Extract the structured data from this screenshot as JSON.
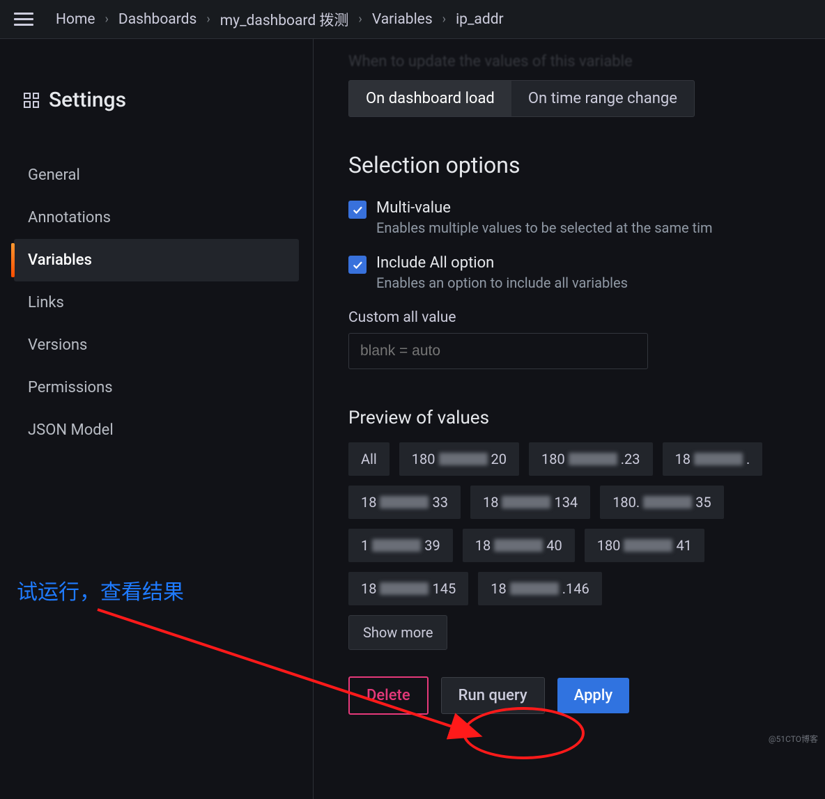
{
  "breadcrumbs": [
    "Home",
    "Dashboards",
    "my_dashboard 拨测",
    "Variables",
    "ip_addr"
  ],
  "sidebar": {
    "title": "Settings",
    "items": [
      "General",
      "Annotations",
      "Variables",
      "Links",
      "Versions",
      "Permissions",
      "JSON Model"
    ],
    "active": "Variables"
  },
  "refresh": {
    "faded_label": "When to update the values of this variable",
    "options": [
      "On dashboard load",
      "On time range change"
    ],
    "active": "On dashboard load"
  },
  "selection": {
    "heading": "Selection options",
    "multi_value": {
      "label": "Multi-value",
      "desc": "Enables multiple values to be selected at the same tim",
      "checked": true
    },
    "include_all": {
      "label": "Include All option",
      "desc": "Enables an option to include all variables",
      "checked": true
    },
    "custom_all_label": "Custom all value",
    "custom_all_placeholder": "blank = auto"
  },
  "preview": {
    "heading": "Preview of values",
    "chips": [
      {
        "pre": "All",
        "mid": "",
        "suf": ""
      },
      {
        "pre": "180",
        "mid": "x",
        "suf": "20"
      },
      {
        "pre": "180",
        "mid": "x",
        "suf": ".23"
      },
      {
        "pre": "18",
        "mid": "x",
        "suf": "."
      },
      {
        "pre": "18",
        "mid": "x",
        "suf": "33"
      },
      {
        "pre": "18",
        "mid": "x",
        "suf": "134"
      },
      {
        "pre": "180.",
        "mid": "x",
        "suf": "35"
      },
      {
        "pre": "1",
        "mid": "x",
        "suf": "39"
      },
      {
        "pre": "18",
        "mid": "x",
        "suf": "40"
      },
      {
        "pre": "180",
        "mid": "x",
        "suf": "41"
      },
      {
        "pre": "18",
        "mid": "x",
        "suf": "145"
      },
      {
        "pre": "18",
        "mid": "x",
        "suf": ".146"
      }
    ],
    "show_more": "Show more"
  },
  "actions": {
    "delete": "Delete",
    "run": "Run query",
    "apply": "Apply"
  },
  "annotation": {
    "text": "试运行，查看结果"
  },
  "watermark": "@51CTO博客"
}
